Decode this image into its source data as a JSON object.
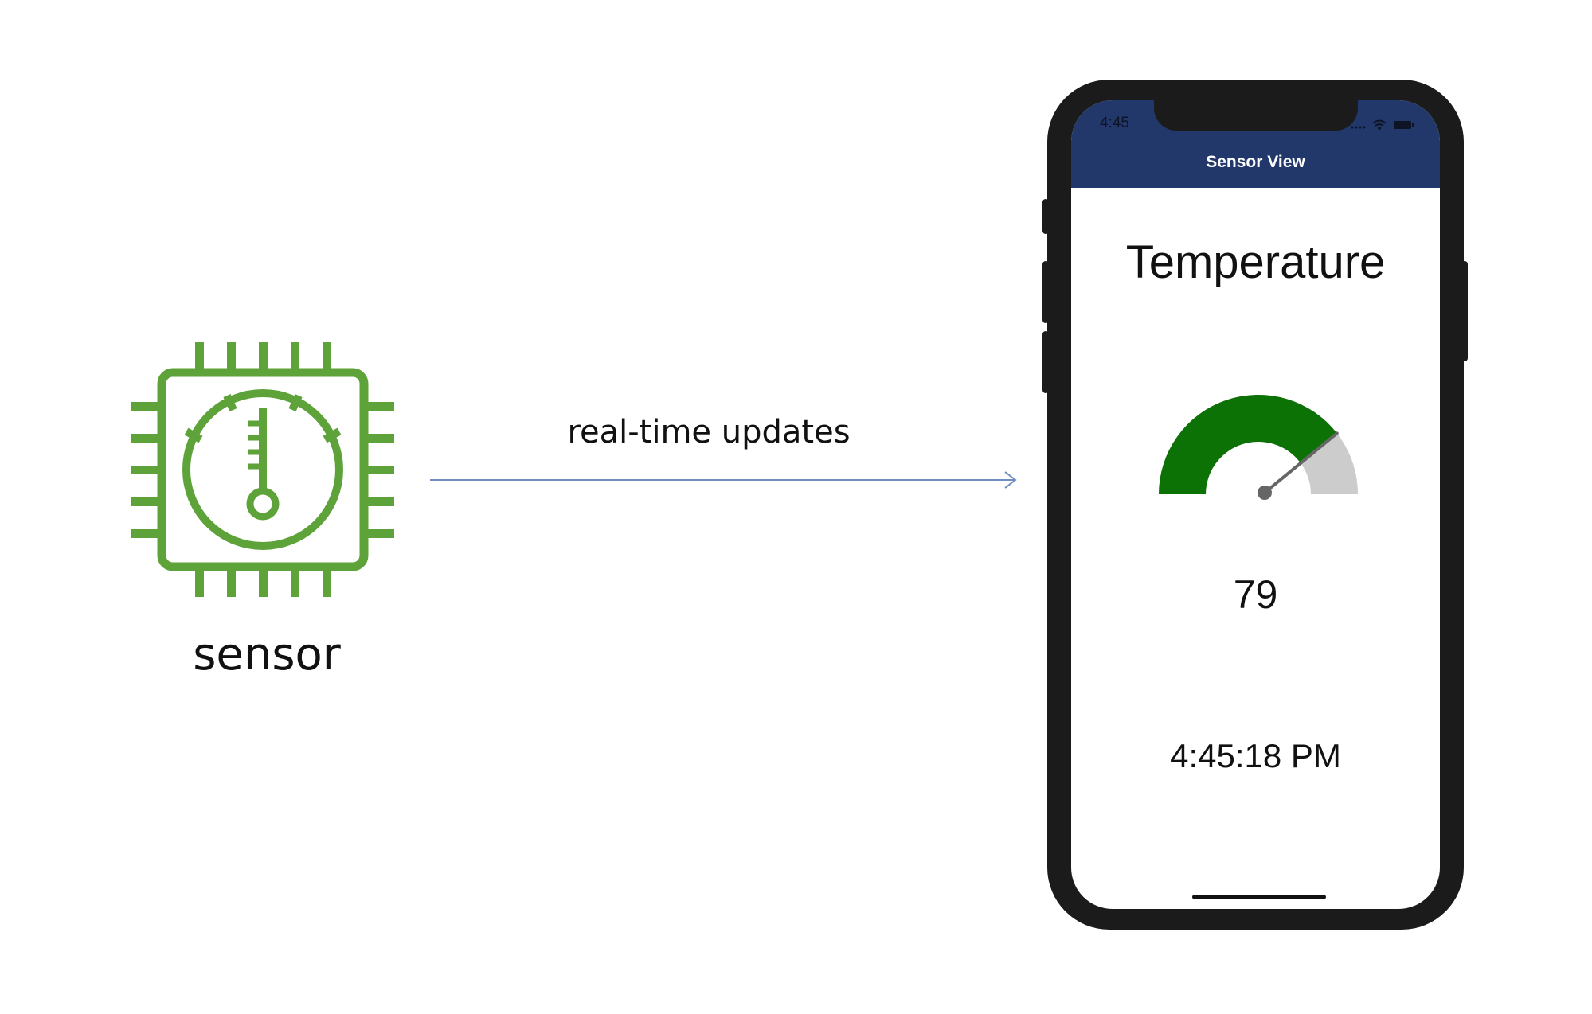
{
  "sensor": {
    "label": "sensor",
    "icon": "chip-thermometer-gauge-icon",
    "color": "#5ea33a"
  },
  "connector": {
    "label": "real-time updates",
    "color": "#6f8fbf"
  },
  "phone": {
    "status_time": "4:45",
    "status_icons": [
      "signal-dots-icon",
      "wifi-icon",
      "battery-icon"
    ],
    "nav_title": "Sensor View",
    "nav_color": "#22376a",
    "heading": "Temperature",
    "gauge": {
      "value": 79,
      "min": 0,
      "max": 100,
      "fill_color": "#0d7206",
      "track_color": "#cccccc"
    },
    "reading": "79",
    "timestamp": "4:45:18 PM"
  }
}
